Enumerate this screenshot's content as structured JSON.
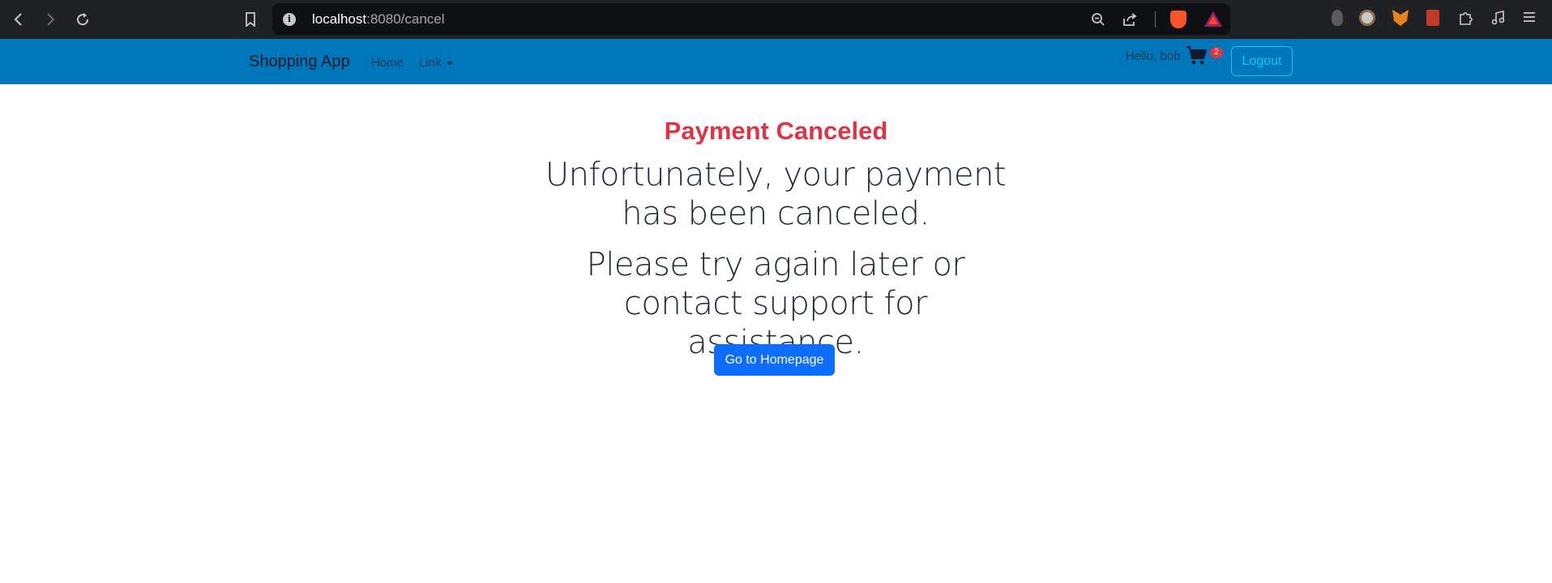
{
  "browser": {
    "url_host": "localhost",
    "url_path": ":8080/cancel",
    "icons": [
      "back-icon",
      "forward-icon",
      "reload-icon",
      "bookmark-icon",
      "site-info-icon",
      "zoom-out-icon",
      "share-icon",
      "brave-shields-icon",
      "brave-rewards-icon",
      "extension-icon",
      "menu-icon"
    ]
  },
  "navbar": {
    "brand": "Shopping App",
    "home": "Home",
    "link": "Link",
    "greeting": "Hello, bob",
    "cart_count": "2",
    "logout": "Logout",
    "background_color": "#0077bb"
  },
  "main": {
    "title": "Payment Canceled",
    "message1": "Unfortunately, your payment has been canceled.",
    "message2": "Please try again later or contact support for assistance.",
    "button": "Go to Homepage",
    "title_color": "#dc3545",
    "button_color": "#0d6efd"
  }
}
